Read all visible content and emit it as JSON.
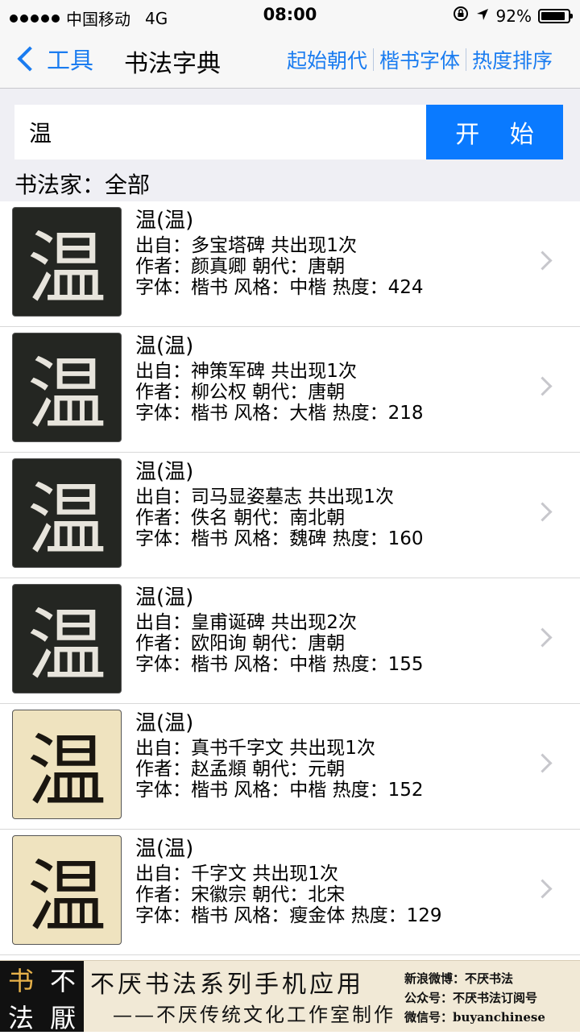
{
  "status": {
    "carrier": "中国移动",
    "network": "4G",
    "time": "08:00",
    "battery": "92%",
    "battery_level": 0.92
  },
  "nav": {
    "back_label": "工具",
    "title": "书法字典",
    "actions": [
      "起始朝代",
      "楷书字体",
      "热度排序"
    ]
  },
  "search": {
    "value": "温",
    "button_label": "开 始",
    "filter_label": "书法家：全部"
  },
  "results": [
    {
      "glyph": "温",
      "title": "温(温)",
      "source": "出自：多宝塔碑 共出现1次",
      "author": "作者：颜真卿 朝代：唐朝",
      "meta": "字体：楷书 风格：中楷 热度：424",
      "tone": "dark"
    },
    {
      "glyph": "温",
      "title": "温(温)",
      "source": "出自：神策军碑 共出现1次",
      "author": "作者：柳公权 朝代：唐朝",
      "meta": "字体：楷书 风格：大楷 热度：218",
      "tone": "dark"
    },
    {
      "glyph": "温",
      "title": "温(温)",
      "source": "出自：司马显姿墓志 共出现1次",
      "author": "作者：佚名 朝代：南北朝",
      "meta": "字体：楷书 风格：魏碑 热度：160",
      "tone": "dark"
    },
    {
      "glyph": "温",
      "title": "温(温)",
      "source": "出自：皇甫诞碑 共出现2次",
      "author": "作者：欧阳询 朝代：唐朝",
      "meta": "字体：楷书 风格：中楷 热度：155",
      "tone": "dark"
    },
    {
      "glyph": "温",
      "title": "温(温)",
      "source": "出自：真书千字文 共出现1次",
      "author": "作者：赵孟頫 朝代：元朝",
      "meta": "字体：楷书 风格：中楷 热度：152",
      "tone": "light"
    },
    {
      "glyph": "温",
      "title": "温(温)",
      "source": "出自：千字文 共出现1次",
      "author": "作者：宋徽宗 朝代：北宋",
      "meta": "字体：楷书 风格：瘦金体 热度：129",
      "tone": "light"
    }
  ],
  "banner": {
    "logo_chars": [
      "书",
      "不",
      "法",
      "厭"
    ],
    "title": "不厌书法系列手机应用",
    "subtitle": "——不厌传统文化工作室制作",
    "weibo": "新浪微博：不厌书法",
    "wechat_account": "公众号：不厌书法订阅号",
    "wechat_id": "微信号：buyanchinese"
  }
}
